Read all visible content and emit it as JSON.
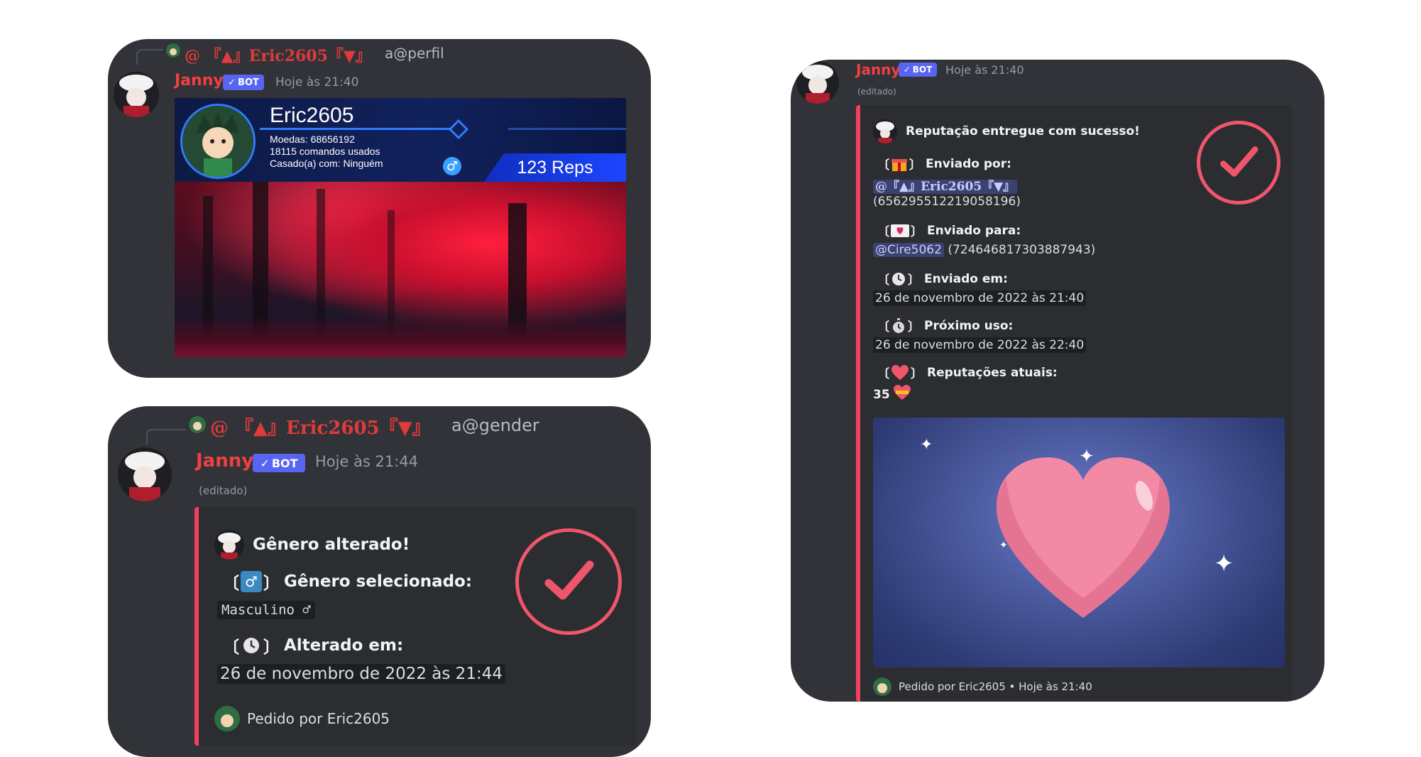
{
  "cards": {
    "profile": {
      "reply": {
        "mention": "@ 『▲』Eric2605『▼』",
        "command": "a@perfil"
      },
      "author": {
        "name": "Janny",
        "badge": "BOT",
        "timestamp": "Hoje às 21:40"
      },
      "profile_image": {
        "name": "Eric2605",
        "coins": "Moedas: 68656192",
        "commands": "18115 comandos usados",
        "married": "Casado(a) com: Ninguém",
        "reps": "123 Reps",
        "gender_symbol": "♂"
      }
    },
    "gender": {
      "reply": {
        "mention": "@ 『▲』Eric2605『▼』",
        "command": "a@gender"
      },
      "author": {
        "name": "Janny",
        "badge": "BOT",
        "timestamp": "Hoje às 21:44",
        "edited": "(editado)"
      },
      "embed": {
        "title": "Gênero alterado!",
        "field1": {
          "icon": "♂",
          "name": "Gênero selecionado:",
          "value": "Masculino ♂"
        },
        "field2": {
          "icon": "🕓",
          "name": "Alterado em:",
          "value": "26 de novembro de 2022 às 21:44"
        },
        "footer": "Pedido por Eric2605"
      }
    },
    "reputation": {
      "author": {
        "name": "Janny",
        "badge": "BOT",
        "timestamp": "Hoje às 21:40",
        "edited": "(editado)"
      },
      "embed": {
        "title": "Reputação entregue com sucesso!",
        "sent_by_label": "Enviado por:",
        "sent_by_mention": "@『▲』Eric2605『▼』",
        "sent_by_id": "(656295512219058196)",
        "sent_to_label": "Enviado para:",
        "sent_to_mention": "@Cire5062",
        "sent_to_id": "(724646817303887943)",
        "sent_at_label": "Enviado em:",
        "sent_at_value": "26 de novembro de 2022 às 21:40",
        "next_use_label": "Próximo uso:",
        "next_use_value": "26 de novembro de 2022 às 22:40",
        "current_reps_label": "Reputações atuais:",
        "current_reps_value": "35",
        "footer": "Pedido por Eric2605 • Hoje às 21:40"
      }
    }
  },
  "colors": {
    "card_bg": "#313338",
    "embed_bg": "#2b2d31",
    "embed_accent": "#f23f5f",
    "username": "#f23f42",
    "bot_badge": "#5865f2",
    "check": "#f0566b"
  },
  "icons": [
    "gift-icon",
    "envelope-icon",
    "clock-icon",
    "stopwatch-icon",
    "heart-icon",
    "male-sign-icon",
    "checkmark-icon"
  ]
}
